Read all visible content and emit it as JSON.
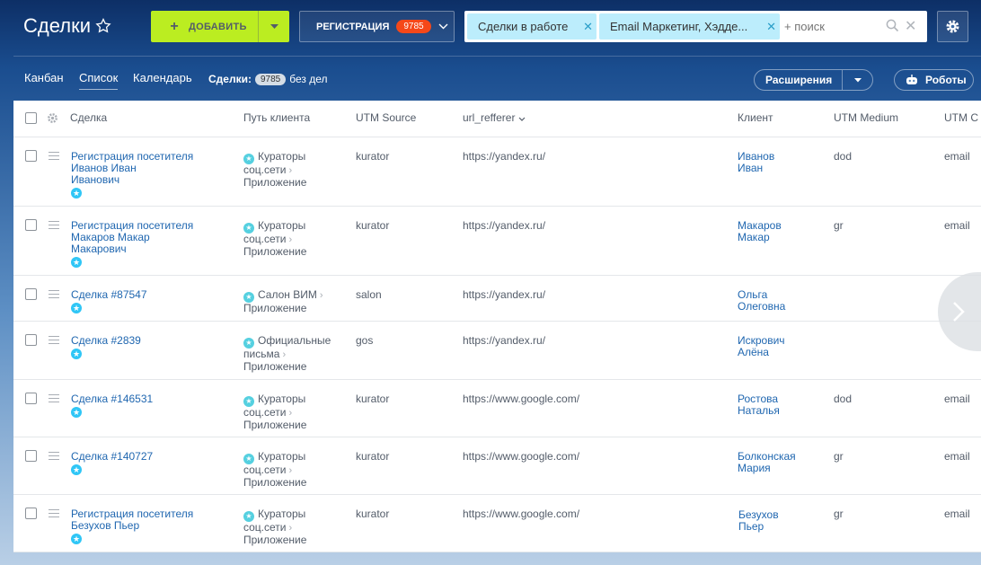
{
  "header": {
    "title": "Сделки",
    "add_label": "ДОБАВИТЬ",
    "registration_label": "РЕГИСТРАЦИЯ",
    "registration_count": "9785",
    "filter_chip_1": "Сделки в работе",
    "filter_chip_2": "Email Маркетинг, Хэдде...",
    "search_placeholder": "+ поиск"
  },
  "viewbar": {
    "tabs": [
      "Канбан",
      "Список",
      "Календарь"
    ],
    "deals_label": "Сделки:",
    "deals_count": "9785",
    "deals_suffix": "без дел",
    "extensions_label": "Расширения",
    "robots_label": "Роботы"
  },
  "columns": [
    "Сделка",
    "Путь клиента",
    "UTM Source",
    "url_refferer",
    "Клиент",
    "UTM Medium",
    "UTM C"
  ],
  "rows": [
    {
      "deal": [
        "Регистрация посетителя",
        "Иванов Иван",
        "Иванович"
      ],
      "path": [
        "Кураторы",
        "соц.сети",
        "Приложение"
      ],
      "source": "kurator",
      "referrer": "https://yandex.ru/",
      "client": [
        "Иванов",
        "Иван"
      ],
      "medium": "dod",
      "campaign": "email"
    },
    {
      "deal": [
        "Регистрация посетителя",
        "Макаров Макар",
        "Макарович"
      ],
      "path": [
        "Кураторы",
        "соц.сети",
        "Приложение"
      ],
      "source": "kurator",
      "referrer": "https://yandex.ru/",
      "client": [
        "Макаров",
        "Макар"
      ],
      "medium": "gr",
      "campaign": "email"
    },
    {
      "deal": [
        "Сделка #87547"
      ],
      "path": [
        "Салон ВИМ",
        "Приложение"
      ],
      "source": "salon",
      "referrer": "https://yandex.ru/",
      "client": [
        "Ольга",
        "Олеговна"
      ],
      "medium": "",
      "campaign": ""
    },
    {
      "deal": [
        "Сделка #2839"
      ],
      "path": [
        "Официальные",
        "письма",
        "Приложение"
      ],
      "source": "gos",
      "referrer": "https://yandex.ru/",
      "client": [
        "Искрович",
        "Алёна"
      ],
      "medium": "",
      "campaign": ""
    },
    {
      "deal": [
        "Сделка #146531"
      ],
      "path": [
        "Кураторы",
        "соц.сети",
        "Приложение"
      ],
      "source": "kurator",
      "referrer": "https://www.google.com/",
      "client": [
        "Ростова",
        "Наталья"
      ],
      "medium": "dod",
      "campaign": "email"
    },
    {
      "deal": [
        "Сделка #140727"
      ],
      "path": [
        "Кураторы",
        "соц.сети",
        "Приложение"
      ],
      "source": "kurator",
      "referrer": "https://www.google.com/",
      "client": [
        "Болконская",
        "Мария"
      ],
      "medium": "gr",
      "campaign": "email"
    },
    {
      "deal": [
        "Регистрация посетителя",
        "Безухов Пьер"
      ],
      "path": [
        "Кураторы",
        "соц.сети",
        "Приложение"
      ],
      "source": "kurator",
      "referrer": "https://www.google.com/",
      "client": [
        "Безухов",
        "Пьер"
      ],
      "medium": "gr",
      "campaign": "email"
    }
  ],
  "colors": {
    "accent_green": "#bbed21",
    "badge_red": "#f54819",
    "chip_blue": "#bcedfc",
    "link_blue": "#2067b0"
  }
}
